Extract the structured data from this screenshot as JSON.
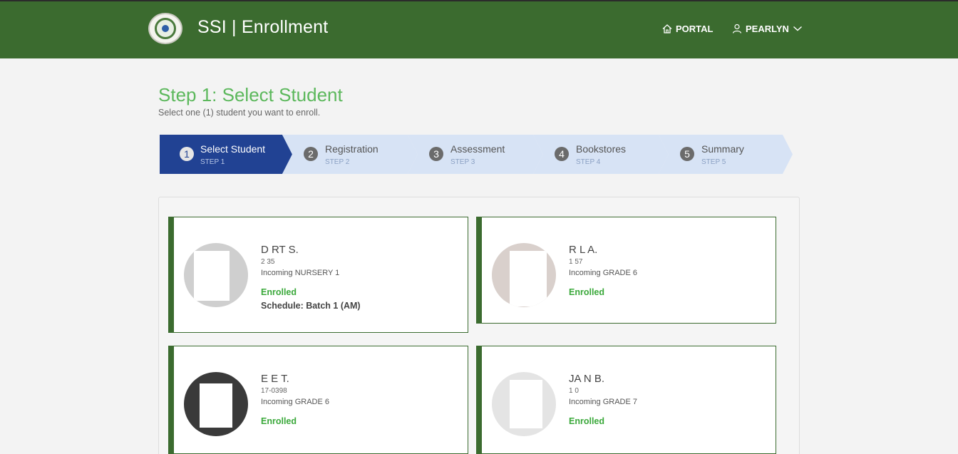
{
  "header": {
    "title": "SSI | Enrollment",
    "portal_label": "PORTAL",
    "user_label": "PEARLYN"
  },
  "page": {
    "title": "Step 1: Select Student",
    "subtitle": "Select one (1) student you want to enroll."
  },
  "steps": [
    {
      "num": "1",
      "label": "Select Student",
      "sub": "STEP 1",
      "active": true
    },
    {
      "num": "2",
      "label": "Registration",
      "sub": "STEP 2",
      "active": false
    },
    {
      "num": "3",
      "label": "Assessment",
      "sub": "STEP 3",
      "active": false
    },
    {
      "num": "4",
      "label": "Bookstores",
      "sub": "STEP 4",
      "active": false
    },
    {
      "num": "5",
      "label": "Summary",
      "sub": "STEP 5",
      "active": false
    }
  ],
  "students": [
    {
      "name": "D            RT S.",
      "id": "2   35",
      "grade": "Incoming NURSERY 1",
      "status": "Enrolled",
      "schedule": "Schedule: Batch 1 (AM)"
    },
    {
      "name": "R                     L A.",
      "id": "1   57",
      "grade": "Incoming GRADE 6",
      "status": "Enrolled",
      "schedule": ""
    },
    {
      "name": "E                       E T.",
      "id": "17-0398",
      "grade": "Incoming GRADE 6",
      "status": "Enrolled",
      "schedule": ""
    },
    {
      "name": "JA                    N B.",
      "id": "1   0",
      "grade": "Incoming GRADE 7",
      "status": "Enrolled",
      "schedule": ""
    }
  ]
}
